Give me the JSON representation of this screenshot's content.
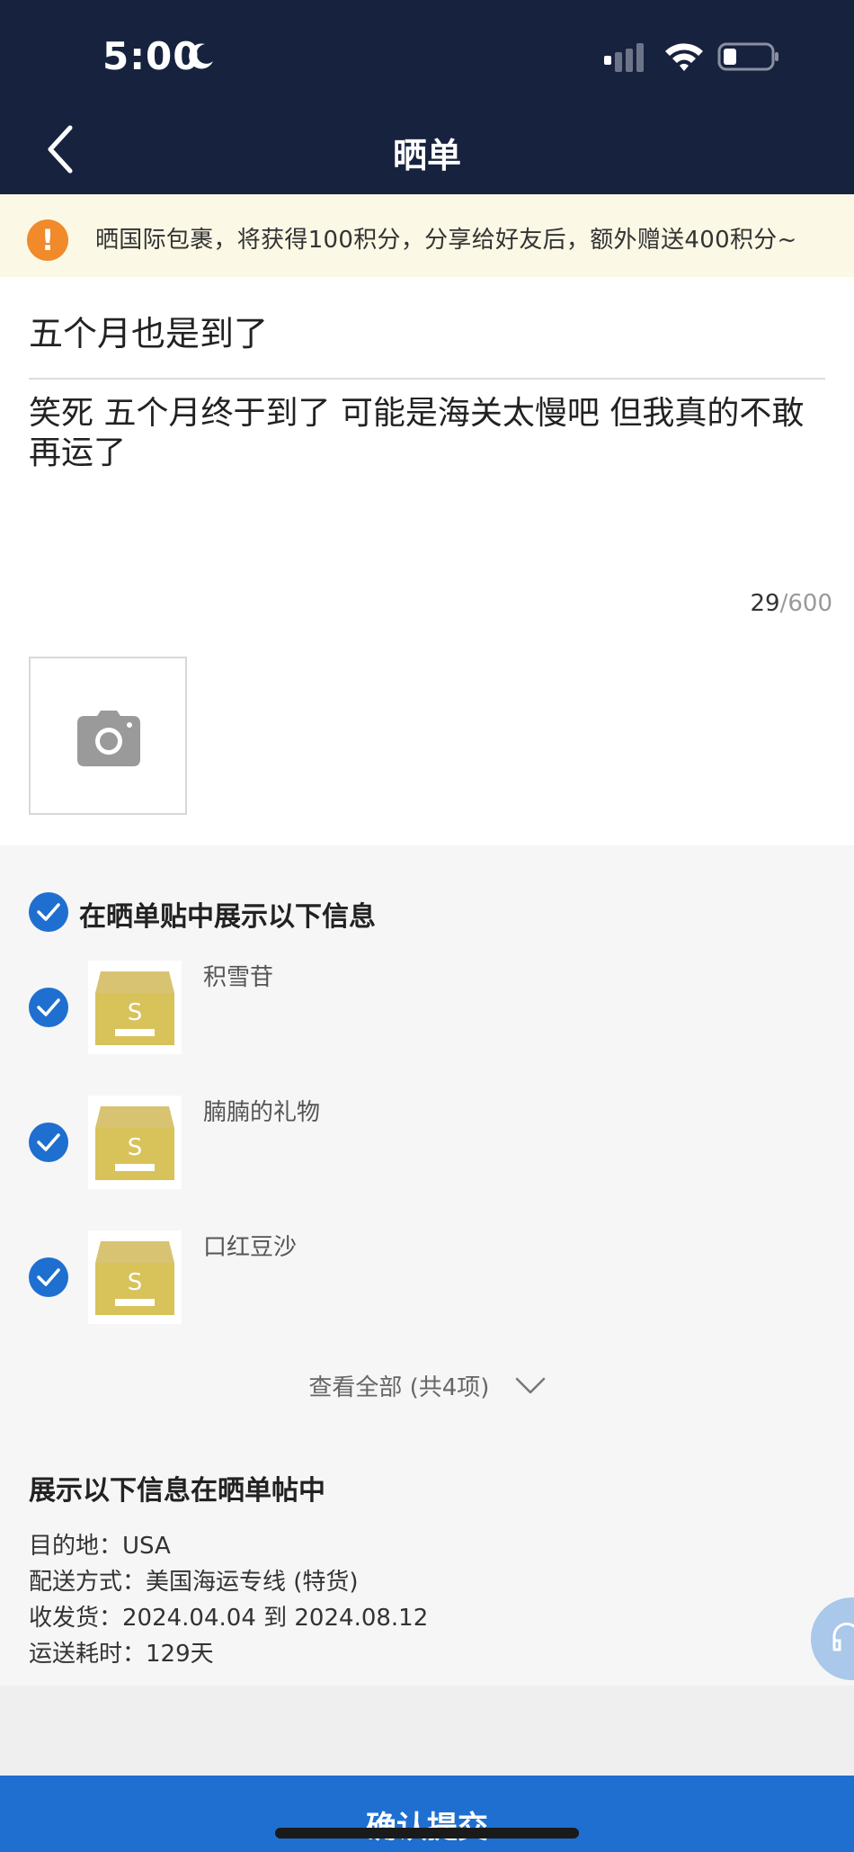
{
  "status_bar": {
    "time": "5:00"
  },
  "nav": {
    "title": "晒单"
  },
  "notice": {
    "text": "晒国际包裹，将获得100积分，分享给好友后，额外赠送400积分~"
  },
  "compose": {
    "title": "五个月也是到了",
    "body": "笑死 五个月终于到了 可能是海关太慢吧 但我真的不敢再运了",
    "count": "29",
    "max": "/600"
  },
  "items_section": {
    "label": "在晒单贴中展示以下信息",
    "items": [
      {
        "name": "积雪苷"
      },
      {
        "name": "腩腩的礼物"
      },
      {
        "name": "口红豆沙"
      }
    ],
    "view_all": "查看全部 (共4项)"
  },
  "info": {
    "title": "展示以下信息在晒单帖中",
    "lines": [
      "目的地：USA",
      "配送方式：美国海运专线 (特货)",
      "收发货：2024.04.04 到 2024.08.12",
      "运送耗时：129天"
    ]
  },
  "submit": {
    "label": "确认提交"
  },
  "colors": {
    "nav_bg": "#17223f",
    "accent": "#1f6fd0",
    "notice_bg": "#fbf8e5",
    "warning": "#f08a2a"
  }
}
